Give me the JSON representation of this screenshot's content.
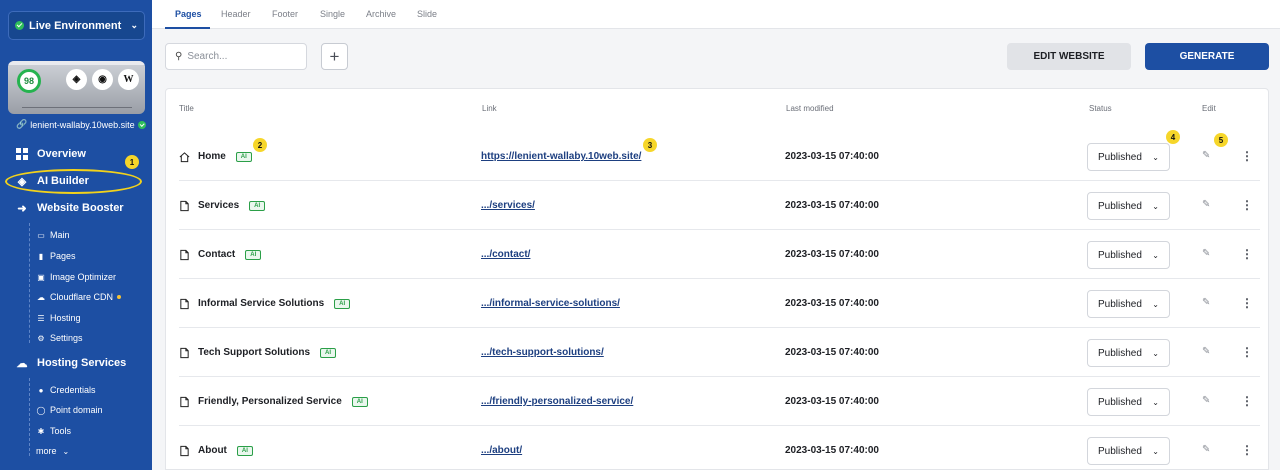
{
  "sidebar": {
    "environment": "Live Environment",
    "score": "98",
    "preview_buttons": [
      "layers-icon",
      "eye-icon",
      "wordpress-icon"
    ],
    "domain": "lenient-wallaby.10web.site",
    "nav": [
      {
        "label": "Overview",
        "icon": "grid-icon"
      },
      {
        "label": "AI Builder",
        "icon": "layers-icon"
      },
      {
        "label": "Website Booster",
        "icon": "bolt-icon"
      }
    ],
    "booster_items": [
      "Main",
      "Pages",
      "Image Optimizer",
      "Cloudflare CDN",
      "Hosting",
      "Settings"
    ],
    "hosting_label": "Hosting Services",
    "hosting_items": [
      "Credentials",
      "Point domain",
      "Tools"
    ],
    "more": "more"
  },
  "tabs": [
    "Pages",
    "Header",
    "Footer",
    "Single",
    "Archive",
    "Slide"
  ],
  "active_tab": "Pages",
  "search_placeholder": "Search...",
  "buttons": {
    "edit_website": "EDIT WEBSITE",
    "generate": "GENERATE"
  },
  "columns": {
    "title": "Title",
    "link": "Link",
    "modified": "Last modified",
    "status": "Status",
    "edit": "Edit"
  },
  "ai_tag": "AI",
  "rows": [
    {
      "title": "Home",
      "link": "https://lenient-wallaby.10web.site/",
      "modified": "2023-03-15 07:40:00",
      "status": "Published"
    },
    {
      "title": "Services",
      "link": ".../services/",
      "modified": "2023-03-15 07:40:00",
      "status": "Published"
    },
    {
      "title": "Contact",
      "link": ".../contact/",
      "modified": "2023-03-15 07:40:00",
      "status": "Published"
    },
    {
      "title": "Informal Service Solutions",
      "link": ".../informal-service-solutions/",
      "modified": "2023-03-15 07:40:00",
      "status": "Published"
    },
    {
      "title": "Tech Support Solutions",
      "link": ".../tech-support-solutions/",
      "modified": "2023-03-15 07:40:00",
      "status": "Published"
    },
    {
      "title": "Friendly, Personalized Service",
      "link": ".../friendly-personalized-service/",
      "modified": "2023-03-15 07:40:00",
      "status": "Published"
    },
    {
      "title": "About",
      "link": ".../about/",
      "modified": "2023-03-15 07:40:00",
      "status": "Published"
    }
  ],
  "callouts": [
    "1",
    "2",
    "3",
    "4",
    "5"
  ],
  "colors": {
    "sidebar": "#1d4fa3",
    "accent": "#1d4fa3",
    "ai_green": "#2b9f48",
    "callout": "#f6d62a"
  }
}
